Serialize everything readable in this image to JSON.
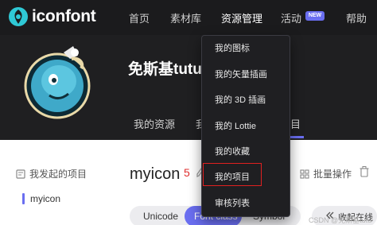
{
  "brand": {
    "name": "iconfont",
    "accent": "#6a6ef0"
  },
  "nav": {
    "home": "首页",
    "materials": "素材库",
    "resources": "资源管理",
    "activity": "活动",
    "activity_badge": "NEW",
    "help": "帮助"
  },
  "profile": {
    "username": "免斯基tutu",
    "tabs": [
      "我的资源",
      "我",
      "目"
    ]
  },
  "dropdown": {
    "items": [
      "我的图标",
      "我的矢量插画",
      "我的 3D 插画",
      "我的 Lottie",
      "我的收藏",
      "我的项目",
      "审核列表"
    ],
    "highlighted": "我的项目"
  },
  "sidebar": {
    "title": "我发起的项目",
    "items": [
      "myicon"
    ]
  },
  "project": {
    "name": "myicon",
    "count": "5",
    "batch_label": "批量操作"
  },
  "format_tabs": [
    "Unicode",
    "Font class",
    "Symbol"
  ],
  "format_active": "Font class",
  "collect_label": "收起在线",
  "watermark": "CSDN @免斯基tutu"
}
